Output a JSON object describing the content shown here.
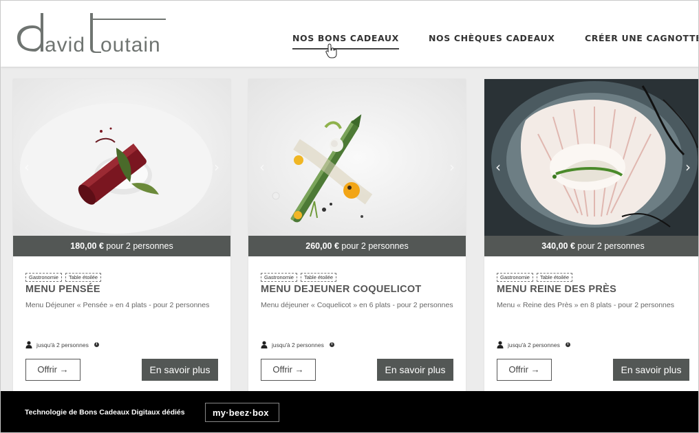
{
  "brand": {
    "logo_text": "david toutain"
  },
  "nav": {
    "items": [
      {
        "label": "NOS BONS CADEAUX",
        "active": true
      },
      {
        "label": "NOS CHÈQUES CADEAUX",
        "active": false
      },
      {
        "label": "CRÉER UNE CAGNOTTE",
        "active": false
      }
    ]
  },
  "cards": [
    {
      "price": "180,00 €",
      "price_suffix": " pour 2 personnes",
      "tags": [
        "Gastronomie",
        "Table étoilée"
      ],
      "title": "MENU PENSÉE",
      "description": "Menu Déjeuner « Pensée » en 4 plats - pour 2 personnes",
      "persons": "jusqu'à 2 personnes",
      "offer_label": "Offrir →",
      "more_label": "En savoir plus"
    },
    {
      "price": "260,00 €",
      "price_suffix": " pour 2 personnes",
      "tags": [
        "Gastronomie",
        "Table étoilée"
      ],
      "title": "MENU DEJEUNER COQUELICOT",
      "description": "Menu déjeuner « Coquelicot » en 6 plats - pour 2 personnes",
      "persons": "jusqu'à 2 personnes",
      "offer_label": "Offrir →",
      "more_label": "En savoir plus"
    },
    {
      "price": "340,00 €",
      "price_suffix": " pour 2 personnes",
      "tags": [
        "Gastronomie",
        "Table étoilée"
      ],
      "title": "MENU REINE DES PRÈS",
      "description": "Menu « Reine des Près » en 8 plats - pour 2 personnes",
      "persons": "jusqu'à 2 personnes",
      "offer_label": "Offrir →",
      "more_label": "En savoir plus"
    }
  ],
  "footer": {
    "text": "Technologie de Bons Cadeaux Digitaux dédiés",
    "badge": "my·beez·box"
  },
  "carousel": {
    "prev_icon": "‹",
    "next_icon": "›"
  },
  "colors": {
    "accent_dark": "#535755",
    "footer_bg": "#000000"
  }
}
